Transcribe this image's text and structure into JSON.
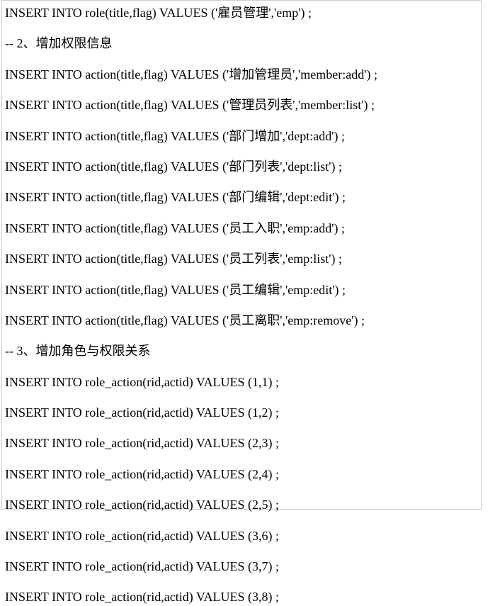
{
  "lines": [
    "INSERT INTO role(title,flag) VALUES ('雇员管理','emp') ;",
    "-- 2、增加权限信息",
    "INSERT INTO action(title,flag) VALUES ('增加管理员','member:add') ;",
    "INSERT INTO action(title,flag) VALUES ('管理员列表','member:list') ;",
    "INSERT INTO action(title,flag) VALUES ('部门增加','dept:add') ;",
    "INSERT INTO action(title,flag) VALUES ('部门列表','dept:list') ;",
    "INSERT INTO action(title,flag) VALUES ('部门编辑','dept:edit') ;",
    "INSERT INTO action(title,flag) VALUES ('员工入职','emp:add') ;",
    "INSERT INTO action(title,flag) VALUES ('员工列表','emp:list') ;",
    "INSERT INTO action(title,flag) VALUES ('员工编辑','emp:edit') ;",
    "INSERT INTO action(title,flag) VALUES ('员工离职','emp:remove') ;",
    "-- 3、增加角色与权限关系",
    "INSERT INTO role_action(rid,actid) VALUES (1,1) ;",
    "INSERT INTO role_action(rid,actid) VALUES (1,2) ;",
    "INSERT INTO role_action(rid,actid) VALUES (2,3) ;",
    "INSERT INTO role_action(rid,actid) VALUES (2,4) ;",
    "INSERT INTO role_action(rid,actid) VALUES (2,5) ;",
    "INSERT INTO role_action(rid,actid) VALUES (3,6) ;",
    "INSERT INTO role_action(rid,actid) VALUES (3,7) ;",
    "INSERT INTO role_action(rid,actid) VALUES (3,8) ;"
  ]
}
